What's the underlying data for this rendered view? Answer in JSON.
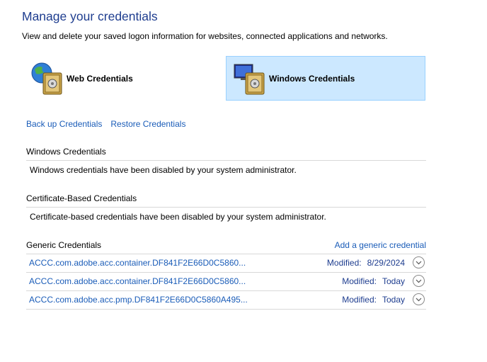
{
  "header": {
    "title": "Manage your credentials",
    "subtitle": "View and delete your saved logon information for websites, connected applications and networks."
  },
  "tiles": {
    "web": {
      "label": "Web Credentials",
      "icon": "globe-vault-icon"
    },
    "windows": {
      "label": "Windows Credentials",
      "icon": "monitor-vault-icon",
      "selected": true
    }
  },
  "actions": {
    "backup": "Back up Credentials",
    "restore": "Restore Credentials"
  },
  "sections": {
    "windows": {
      "title": "Windows Credentials",
      "message": "Windows credentials have been disabled by your system administrator."
    },
    "certificate": {
      "title": "Certificate-Based Credentials",
      "message": "Certificate-based credentials have been disabled by your system administrator."
    },
    "generic": {
      "title": "Generic Credentials",
      "add_link": "Add a generic credential",
      "items": [
        {
          "name": "ACCC.com.adobe.acc.container.DF841F2E66D0C5860...",
          "modified_label": "Modified:",
          "modified_value": "8/29/2024"
        },
        {
          "name": "ACCC.com.adobe.acc.container.DF841F2E66D0C5860...",
          "modified_label": "Modified:",
          "modified_value": "Today"
        },
        {
          "name": "ACCC.com.adobe.acc.pmp.DF841F2E66D0C5860A495...",
          "modified_label": "Modified:",
          "modified_value": "Today"
        }
      ]
    }
  },
  "colors": {
    "title": "#1e3d8f",
    "link": "#1a5cb8",
    "selected_tile": "#cce8ff",
    "selected_border": "#99d1ff"
  }
}
